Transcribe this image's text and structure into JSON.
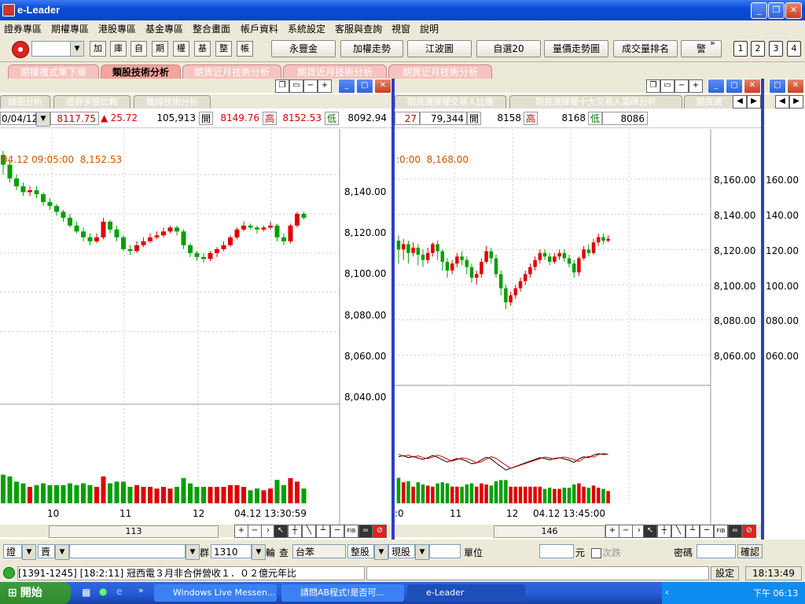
{
  "app": {
    "title": "e-Leader"
  },
  "menu": [
    "證券專區",
    "期權專區",
    "港股專區",
    "基金專區",
    "整合畫面",
    "帳戶資料",
    "系統設定",
    "客服與查詢",
    "視窗",
    "說明"
  ],
  "toolbar": {
    "small_buttons": [
      "加",
      "庫",
      "自",
      "期",
      "權",
      "基",
      "整",
      "帳"
    ],
    "buttons": [
      "永豐金",
      "加權走勢",
      "江波圖",
      "自選20",
      "量價走勢圖",
      "成交量排名",
      "警"
    ],
    "numbers": [
      "1",
      "2",
      "3",
      "4"
    ]
  },
  "page_tabs": [
    "期權複式單下單",
    "類股技術分析",
    "期貨近月技術分析",
    "期貨近月技術分析",
    "期貨近月技術分析"
  ],
  "left_window": {
    "subtabs": [
      "線圖分析",
      "證券多股比較",
      "離線技術分析"
    ],
    "quote": {
      "date": "0/04/12",
      "price": "8117.75",
      "change_arrow": "▲",
      "change": "25.72",
      "volume": "105,913",
      "open_label": "開",
      "open": "8149.76",
      "high_label": "高",
      "high": "8152.53",
      "low_label": "低",
      "low": "8092.94"
    },
    "info": "04.12 09:05:00  8,152.53",
    "y_ticks": [
      "8,140.00",
      "8,120.00",
      "8,100.00",
      "8,080.00",
      "8,060.00",
      "8,040.00"
    ],
    "x_labels": [
      "10",
      "11",
      "12"
    ],
    "timestamp": "04.12 13:30:59",
    "scroll_value": "113"
  },
  "right_window": {
    "subtabs": [
      "期貨選擇權交易人比重",
      "期貨選擇權十大交易人籌碼分析",
      "期貨選"
    ],
    "quote": {
      "change": "27",
      "volume": "79,344",
      "open_label": "開",
      "open": "8158",
      "high_label": "高",
      "high": "8168",
      "low_label": "低",
      "low": "8086"
    },
    "info": ":0:00  8,168.00",
    "y_ticks": [
      "8,160.00",
      "8,140.00",
      "8,120.00",
      "8,100.00",
      "8,080.00",
      "8,060.00"
    ],
    "x_labels": [
      ":0",
      "11",
      "12"
    ],
    "timestamp": "04.12 13:45:00",
    "scroll_value": "146"
  },
  "far_right": {
    "y_ticks": [
      "160.00",
      "140.00",
      "120.00",
      "100.00",
      "080.00",
      "060.00"
    ]
  },
  "order_bar": {
    "account": "證",
    "side": "賣",
    "group_label": "群",
    "group_value": "1310",
    "wheel": "輪",
    "query": "查",
    "stock_name": "台苯",
    "lot_type": "整股",
    "cash_type": "現股",
    "unit_label": "單位",
    "currency": "元",
    "checkbox_label": "次跌",
    "password_label": "密碼",
    "confirm": "確認"
  },
  "status_bar": {
    "ticker": "[1391-1245] [18:2:11] 冠西電３月非合併營收１．０２億元年比",
    "setting": "設定",
    "clock": "18:13:49"
  },
  "taskbar": {
    "start": "開始",
    "tasks": [
      "Windows Live Messen...",
      "請問AB程式!是否可...",
      "e-Leader"
    ],
    "time": "下午 06:13"
  },
  "chart_data": [
    {
      "type": "candlestick",
      "title": "",
      "ylabel": "",
      "ylim": [
        8035,
        8160
      ],
      "series": [
        {
          "name": "",
          "values": [
            [
              8150,
              8145,
              8152,
              8140
            ],
            [
              8145,
              8138,
              8147,
              8136
            ],
            [
              8138,
              8134,
              8140,
              8132
            ],
            [
              8134,
              8131,
              8136,
              8129
            ],
            [
              8131,
              8132,
              8134,
              8129
            ],
            [
              8132,
              8130,
              8134,
              8128
            ],
            [
              8130,
              8126,
              8131,
              8124
            ],
            [
              8126,
              8124,
              8128,
              8122
            ],
            [
              8124,
              8121,
              8125,
              8119
            ],
            [
              8121,
              8118,
              8122,
              8116
            ],
            [
              8118,
              8114,
              8120,
              8113
            ],
            [
              8114,
              8111,
              8116,
              8110
            ],
            [
              8111,
              8108,
              8113,
              8106
            ],
            [
              8108,
              8106,
              8110,
              8104
            ],
            [
              8106,
              8108,
              8110,
              8105
            ],
            [
              8108,
              8116,
              8118,
              8107
            ],
            [
              8116,
              8112,
              8117,
              8110
            ],
            [
              8112,
              8108,
              8114,
              8106
            ],
            [
              8108,
              8102,
              8109,
              8101
            ],
            [
              8102,
              8101,
              8104,
              8099
            ],
            [
              8101,
              8104,
              8106,
              8100
            ],
            [
              8104,
              8106,
              8108,
              8103
            ],
            [
              8106,
              8108,
              8110,
              8105
            ],
            [
              8108,
              8109,
              8111,
              8107
            ],
            [
              8109,
              8111,
              8113,
              8108
            ],
            [
              8111,
              8113,
              8114,
              8110
            ],
            [
              8113,
              8111,
              8114,
              8109
            ],
            [
              8111,
              8104,
              8112,
              8102
            ],
            [
              8104,
              8100,
              8105,
              8098
            ],
            [
              8100,
              8098,
              8101,
              8096
            ],
            [
              8098,
              8097,
              8100,
              8095
            ],
            [
              8097,
              8100,
              8101,
              8096
            ],
            [
              8100,
              8102,
              8103,
              8098
            ],
            [
              8102,
              8104,
              8106,
              8101
            ],
            [
              8104,
              8108,
              8109,
              8103
            ],
            [
              8108,
              8112,
              8113,
              8107
            ],
            [
              8112,
              8114,
              8116,
              8111
            ],
            [
              8114,
              8113,
              8115,
              8112
            ],
            [
              8113,
              8112,
              8114,
              8110
            ],
            [
              8112,
              8113,
              8114,
              8111
            ],
            [
              8113,
              8114,
              8116,
              8112
            ],
            [
              8114,
              8108,
              8115,
              8106
            ],
            [
              8108,
              8106,
              8110,
              8104
            ],
            [
              8106,
              8114,
              8115,
              8105
            ],
            [
              8114,
              8120,
              8121,
              8113
            ],
            [
              8120,
              8118,
              8121,
              8117
            ]
          ]
        }
      ]
    },
    {
      "type": "candlestick",
      "title": "",
      "ylabel": "",
      "ylim": [
        8050,
        8175
      ],
      "series": [
        {
          "name": "",
          "values": [
            [
              8125,
              8120,
              8128,
              8112
            ],
            [
              8120,
              8123,
              8126,
              8114
            ],
            [
              8123,
              8118,
              8125,
              8112
            ],
            [
              8118,
              8121,
              8124,
              8116
            ],
            [
              8121,
              8117,
              8123,
              8111
            ],
            [
              8117,
              8114,
              8120,
              8110
            ],
            [
              8114,
              8118,
              8121,
              8112
            ],
            [
              8118,
              8123,
              8124,
              8116
            ],
            [
              8123,
              8119,
              8125,
              8114
            ],
            [
              8119,
              8113,
              8120,
              8108
            ],
            [
              8113,
              8108,
              8115,
              8104
            ],
            [
              8108,
              8112,
              8114,
              8106
            ],
            [
              8112,
              8116,
              8118,
              8110
            ],
            [
              8116,
              8114,
              8119,
              8111
            ],
            [
              8114,
              8110,
              8116,
              8106
            ],
            [
              8110,
              8104,
              8112,
              8101
            ],
            [
              8104,
              8106,
              8108,
              8100
            ],
            [
              8106,
              8113,
              8115,
              8104
            ],
            [
              8113,
              8119,
              8122,
              8112
            ],
            [
              8119,
              8115,
              8121,
              8112
            ],
            [
              8115,
              8106,
              8117,
              8104
            ],
            [
              8106,
              8098,
              8108,
              8094
            ],
            [
              8098,
              8090,
              8100,
              8086
            ],
            [
              8090,
              8094,
              8096,
              8088
            ],
            [
              8094,
              8098,
              8100,
              8092
            ],
            [
              8098,
              8102,
              8104,
              8096
            ],
            [
              8102,
              8106,
              8108,
              8100
            ],
            [
              8106,
              8110,
              8112,
              8104
            ],
            [
              8110,
              8114,
              8116,
              8108
            ],
            [
              8114,
              8118,
              8120,
              8112
            ],
            [
              8118,
              8116,
              8120,
              8114
            ],
            [
              8116,
              8113,
              8118,
              8111
            ],
            [
              8113,
              8116,
              8118,
              8112
            ],
            [
              8116,
              8118,
              8120,
              8114
            ],
            [
              8118,
              8115,
              8120,
              8113
            ],
            [
              8115,
              8112,
              8117,
              8110
            ],
            [
              8112,
              8107,
              8114,
              8104
            ],
            [
              8107,
              8115,
              8116,
              8105
            ],
            [
              8115,
              8120,
              8122,
              8114
            ],
            [
              8120,
              8118,
              8123,
              8116
            ],
            [
              8118,
              8124,
              8126,
              8117
            ],
            [
              8124,
              8127,
              8129,
              8122
            ],
            [
              8127,
              8125,
              8129,
              8123
            ],
            [
              8125,
              8126,
              8128,
              8124
            ]
          ]
        }
      ]
    }
  ]
}
